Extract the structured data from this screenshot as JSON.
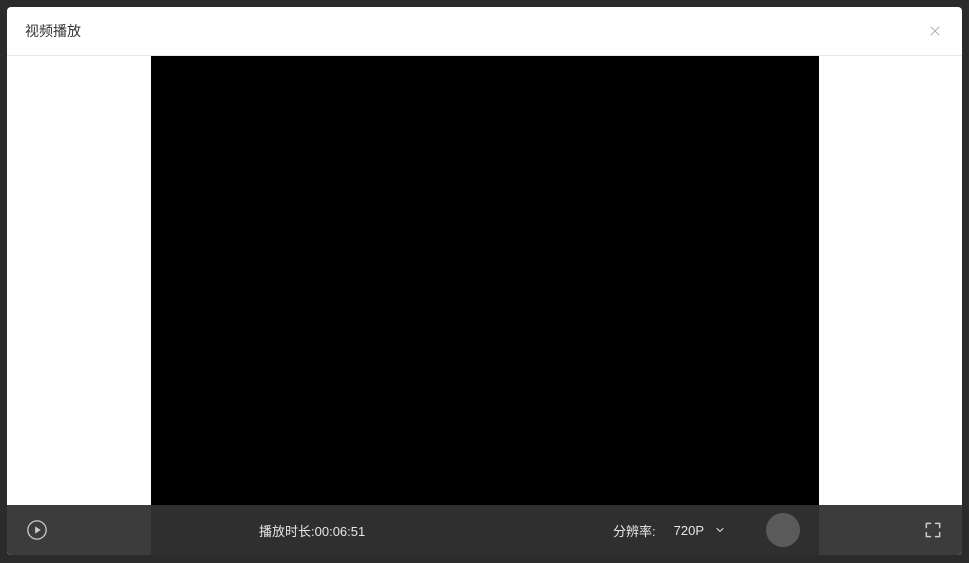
{
  "modal": {
    "title": "视频播放"
  },
  "player": {
    "duration_label": "播放时长:",
    "duration_value": "00:06:51",
    "resolution_label": "分辨率:",
    "resolution_value": "720P"
  }
}
